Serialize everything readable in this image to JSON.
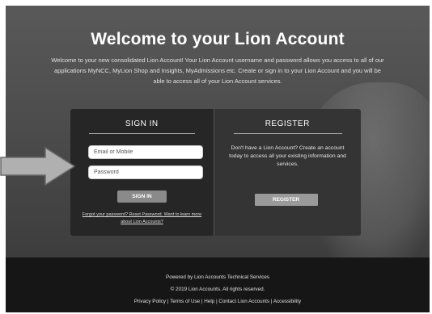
{
  "hero": {
    "title": "Welcome to your Lion Account",
    "intro": "Welcome to your new consolidated Lion Account! Your Lion Account username and password allows you access to all of our applications MyNCC, MyLion Shop and Insights, MyAdmissions etc. Create or sign in to your Lion Account and you will be able to access all of your Lion Account services."
  },
  "signin": {
    "title": "SIGN IN",
    "email_placeholder": "Email or Mobile",
    "password_placeholder": "Password",
    "button_label": "SIGN IN",
    "forgot_text": "Forgot your password? Reset Password. Want to learn more about Lion Accounts?"
  },
  "register": {
    "title": "REGISTER",
    "text": "Don't have a Lion Account? Create an account today to access all your existing information and services.",
    "button_label": "REGISTER"
  },
  "footer": {
    "line1": "Powered by Lion Accounts Technical Services",
    "line2": "© 2019 Lion Accounts. All rights reserved.",
    "line3": "Privacy Policy | Terms of Use | Help | Contact Lion Accounts | Accessibility"
  },
  "annotation": {
    "arrow_icon": "right-arrow-icon",
    "arrow_color": "#b0b0b0"
  }
}
